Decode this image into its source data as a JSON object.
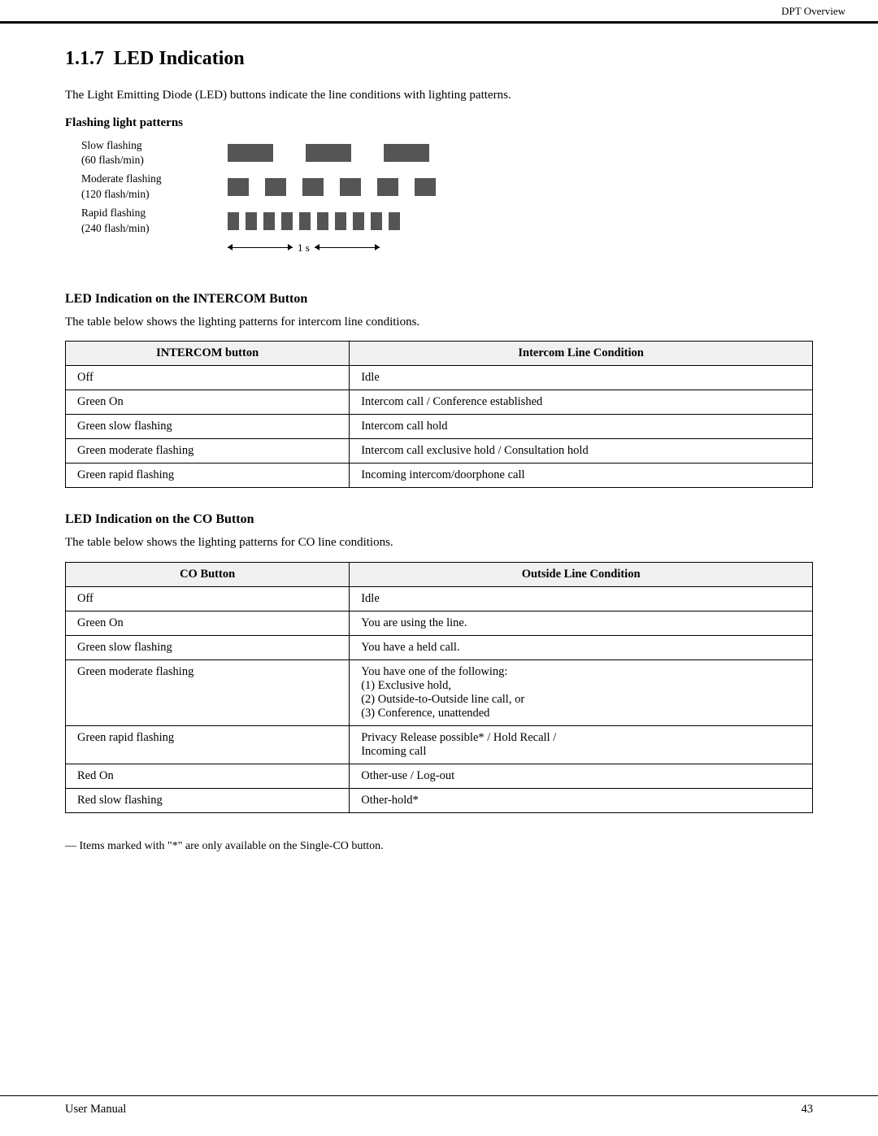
{
  "header": {
    "title": "DPT Overview"
  },
  "section": {
    "number": "1.1.7",
    "title": "LED Indication",
    "intro": "The Light Emitting Diode (LED) buttons indicate the line conditions with lighting patterns.",
    "flashing_label": "Flashing light patterns",
    "flash_rows": [
      {
        "label_line1": "Slow flashing",
        "label_line2": "(60 flash/min)",
        "type": "slow"
      },
      {
        "label_line1": "Moderate flashing",
        "label_line2": "(120 flash/min)",
        "type": "moderate"
      },
      {
        "label_line1": "Rapid flashing",
        "label_line2": "(240 flash/min)",
        "type": "rapid"
      }
    ],
    "time_label": "1 s",
    "intercom_section": {
      "heading": "LED Indication on the INTERCOM Button",
      "intro": "The table below shows the lighting patterns for intercom line conditions.",
      "col1_header": "INTERCOM button",
      "col2_header": "Intercom Line Condition",
      "rows": [
        {
          "col1": "Off",
          "col2": "Idle"
        },
        {
          "col1": "Green On",
          "col2": "Intercom call / Conference established"
        },
        {
          "col1": "Green slow flashing",
          "col2": "Intercom call hold"
        },
        {
          "col1": "Green moderate flashing",
          "col2": "Intercom call exclusive hold / Consultation hold"
        },
        {
          "col1": "Green rapid flashing",
          "col2": "Incoming intercom/doorphone call"
        }
      ]
    },
    "co_section": {
      "heading": "LED Indication on the CO Button",
      "intro": "The table below shows the lighting patterns for CO line conditions.",
      "col1_header": "CO Button",
      "col2_header": "Outside Line Condition",
      "rows": [
        {
          "col1": "Off",
          "col2": "Idle"
        },
        {
          "col1": "Green On",
          "col2": "You are using the line."
        },
        {
          "col1": "Green slow flashing",
          "col2": "You have a held call."
        },
        {
          "col1": "Green moderate flashing",
          "col2": "You have one of the following:\n(1) Exclusive hold,\n(2) Outside-to-Outside line call, or\n(3) Conference, unattended"
        },
        {
          "col1": "Green rapid flashing",
          "col2": "Privacy Release possible* / Hold Recall /\nIncoming call"
        },
        {
          "col1": "Red On",
          "col2": "Other-use / Log-out"
        },
        {
          "col1": "Red slow flashing",
          "col2": "Other-hold*"
        }
      ]
    },
    "footnote": "— Items marked with \"*\" are only available on the Single-CO button."
  },
  "footer": {
    "left": "User Manual",
    "right": "43"
  }
}
